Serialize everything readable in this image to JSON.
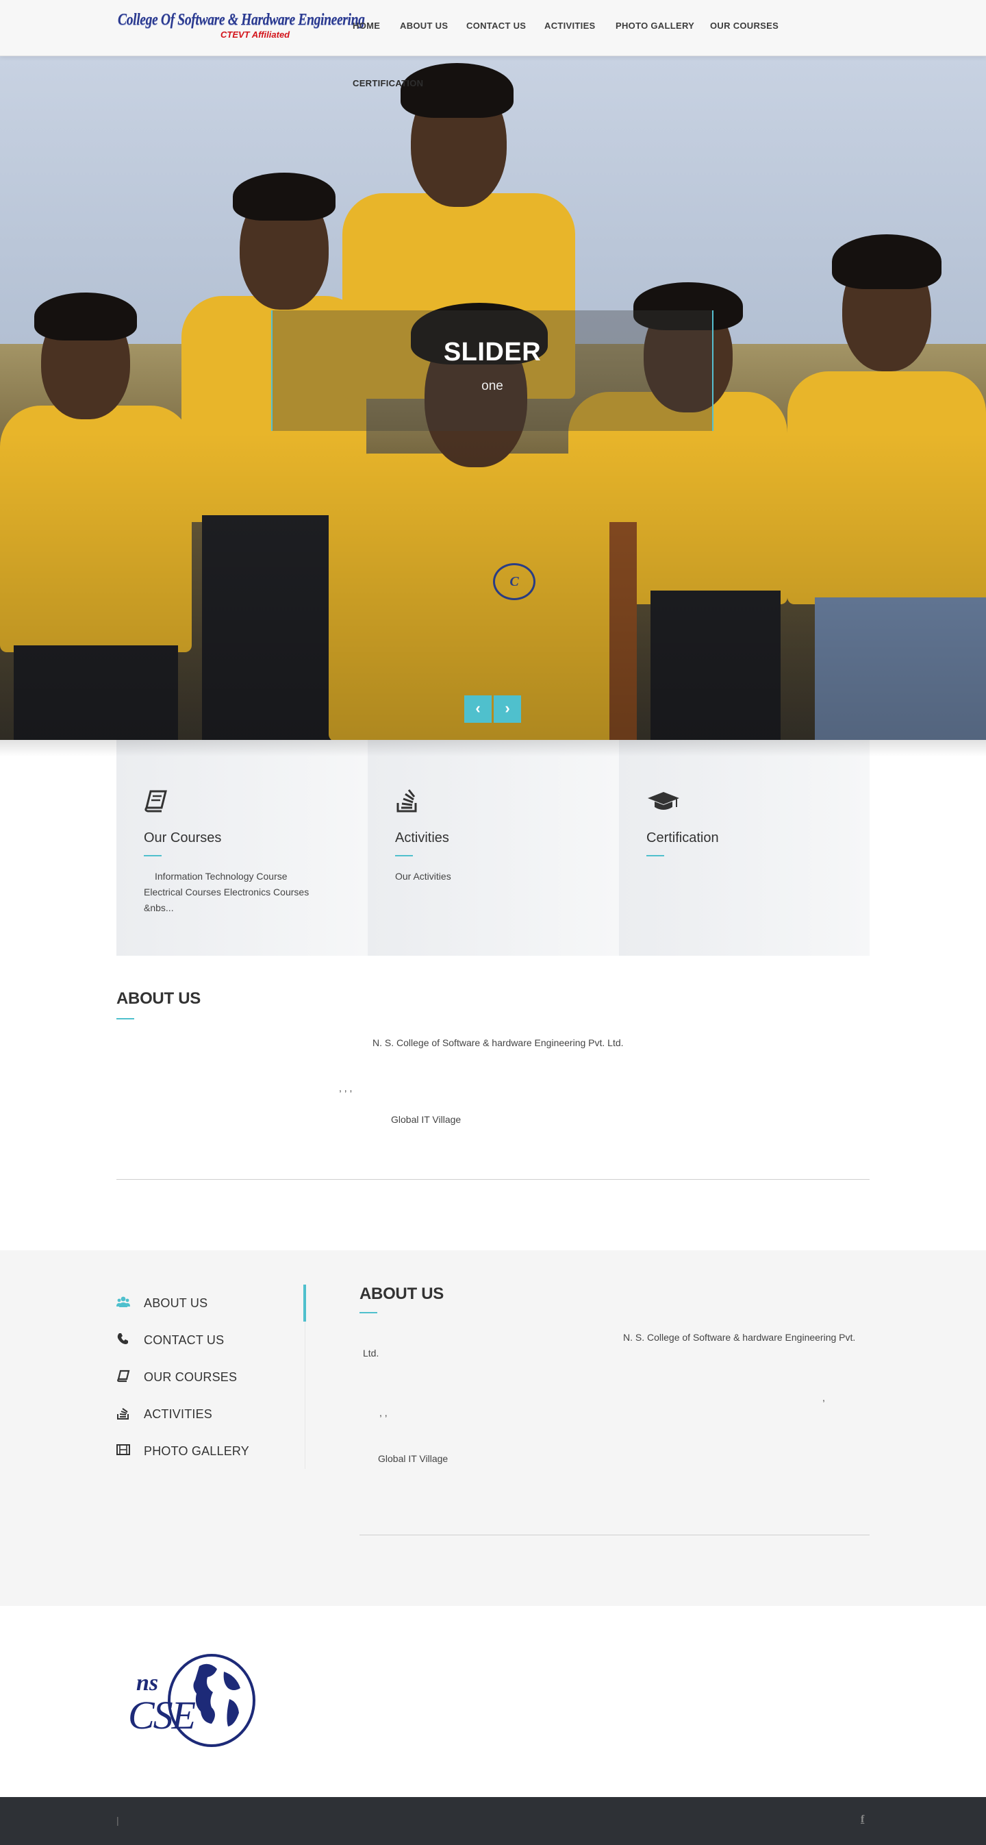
{
  "header": {
    "logo_title": "College Of Software & Hardware Engineering",
    "logo_subtitle": "CTEVT Affiliated",
    "nav": [
      "HOME",
      "ABOUT US",
      "CONTACT US",
      "ACTIVITIES",
      "PHOTO GALLERY",
      "OUR COURSES",
      "CERTIFICATION"
    ]
  },
  "hero": {
    "title": "SLIDER",
    "subtitle": "one",
    "prev_icon": "chevron-left-icon",
    "next_icon": "chevron-right-icon",
    "emblem_text": "CSE"
  },
  "features": [
    {
      "icon": "book-icon",
      "title": "Our Courses",
      "text": "Information Technology Course Electrical Courses  Electronics Courses &nbs..."
    },
    {
      "icon": "stack-icon",
      "title": "Activities",
      "text": "Our Activities"
    },
    {
      "icon": "graduation-cap-icon",
      "title": "Certification",
      "text": ""
    }
  ],
  "about": {
    "title": "ABOUT US",
    "line1": "N. S. College of Software & hardware Engineering Pvt. Ltd.",
    "commas": ",          ,          ,",
    "line3": "Global IT Village"
  },
  "side_menu": [
    {
      "icon": "users-icon",
      "label": "ABOUT US"
    },
    {
      "icon": "phone-icon",
      "label": "CONTACT US"
    },
    {
      "icon": "book-icon",
      "label": "OUR COURSES"
    },
    {
      "icon": "stack-icon",
      "label": "ACTIVITIES"
    },
    {
      "icon": "film-icon",
      "label": "PHOTO GALLERY"
    }
  ],
  "about2": {
    "title": "ABOUT US",
    "line1": "N. S. College of Software & hardware Engineering Pvt.",
    "line1b": "Ltd.",
    "comma_a": ",",
    "commas_b": ",          ,",
    "line3": "Global IT Village"
  },
  "bottom_logo": {
    "text_top": "ns",
    "text_main": "CSE"
  },
  "footer": {
    "separator": "|",
    "social_icon": "facebook-icon",
    "social_glyph": "f"
  },
  "colors": {
    "accent": "#4fc0cd",
    "footer_bg": "#2e3136",
    "band_bg": "#f5f5f5"
  }
}
